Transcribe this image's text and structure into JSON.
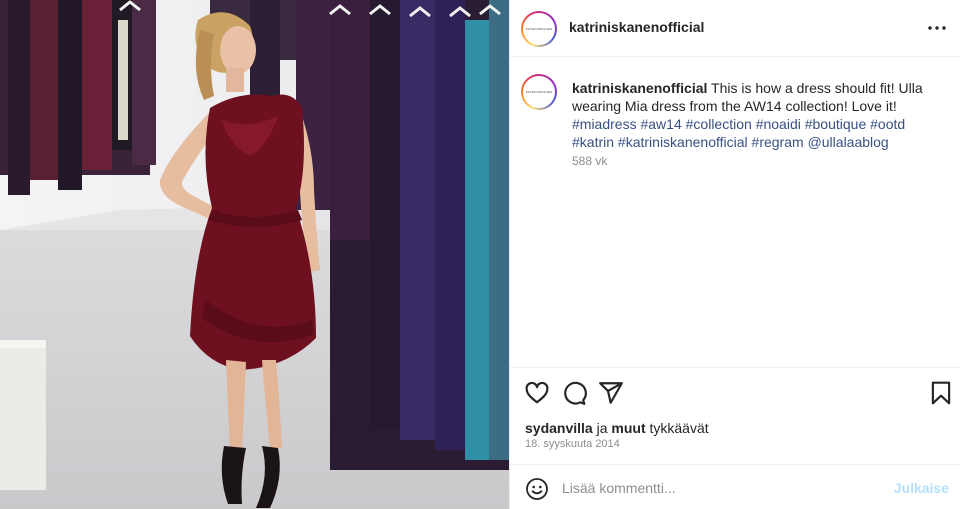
{
  "post": {
    "username": "katriniskanenofficial",
    "avatar_text": "KATRINISKANEN",
    "caption_prefix": "This is how a dress should fit! Ulla wearing Mia dress from the AW14 collection! Love it!",
    "hashtags": [
      "#miadress",
      "#aw14",
      "#collection",
      "#noaidi",
      "#boutique",
      "#ootd",
      "#katrin",
      "#katriniskanenofficial",
      "#regram"
    ],
    "mention": "@ullalaablog",
    "caption_age": "588 vk",
    "likes_user": "sydanvilla",
    "likes_and": "ja",
    "likes_others": "muut",
    "likes_suffix": "tykkäävät",
    "date": "18. syyskuuta 2014"
  },
  "comment": {
    "placeholder": "Lisää kommentti...",
    "post_label": "Julkaise"
  },
  "icons": {
    "more": "more-options-icon",
    "like": "heart-icon",
    "comment": "comment-icon",
    "share": "share-icon",
    "save": "bookmark-icon",
    "emoji": "emoji-icon"
  },
  "colors": {
    "link": "#385185",
    "muted": "#8e8e8e",
    "post_button": "#b2dffc",
    "dress": "#6e1020"
  }
}
